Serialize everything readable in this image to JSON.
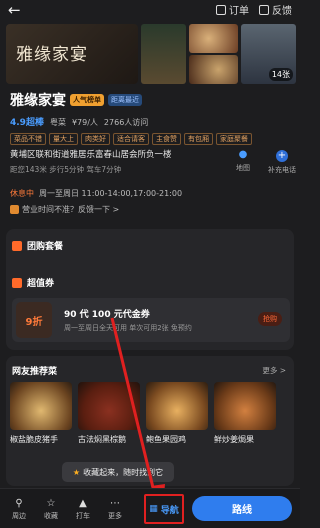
{
  "topbar": {
    "back_icon": "arrow-left-icon",
    "orders_label": "订单",
    "feedback_label": "反馈"
  },
  "gallery": {
    "logo_text": "雅缘家宴",
    "count_badge": "14张"
  },
  "restaurant": {
    "name": "雅缘家宴",
    "badge_popular": "人气榜单",
    "badge_recent": "距离最近",
    "score": "4.9超棒",
    "cuisine": "粤菜",
    "price": "¥79/人",
    "visits": "2766人访问",
    "tags": [
      "菜品不错",
      "量大上",
      "肉类好",
      "适合请客",
      "主食赞",
      "有包厢",
      "家庭聚餐"
    ]
  },
  "address": {
    "line": "黄埔区联和街道雅居乐富春山居会所负一楼",
    "sub": "距您143米  步行5分钟  驾车7分钟",
    "map_label": "地图",
    "phone_label": "补充电话"
  },
  "hours": {
    "status": "休息中",
    "schedule": "周一至周日 11:00-14:00,17:00-21:00"
  },
  "feedback": {
    "text": "营业时间不准？反馈一下 >"
  },
  "group_deal": {
    "header": "团购套餐",
    "coupon_header": "超值券",
    "coupon": {
      "discount": "9折",
      "title": "90 代 100 元代金券",
      "sub": "周一至周日全天可用 单次可用2张 免预约",
      "button": "抢购"
    }
  },
  "recommend": {
    "header": "网友推荐菜",
    "more": "更多 >",
    "dishes": [
      {
        "name": "椒盐脆皮猪手"
      },
      {
        "name": "古法焖黑棕鹅"
      },
      {
        "name": "鲍鱼果园鸡"
      },
      {
        "name": "鲜炒姜焗果"
      }
    ]
  },
  "toast": {
    "text": "收藏起来，随时找到它"
  },
  "bottom_nav": {
    "nearby": "周边",
    "favorite": "收藏",
    "taxi": "打车",
    "more": "更多",
    "navigate": "导航",
    "route": "路线"
  }
}
